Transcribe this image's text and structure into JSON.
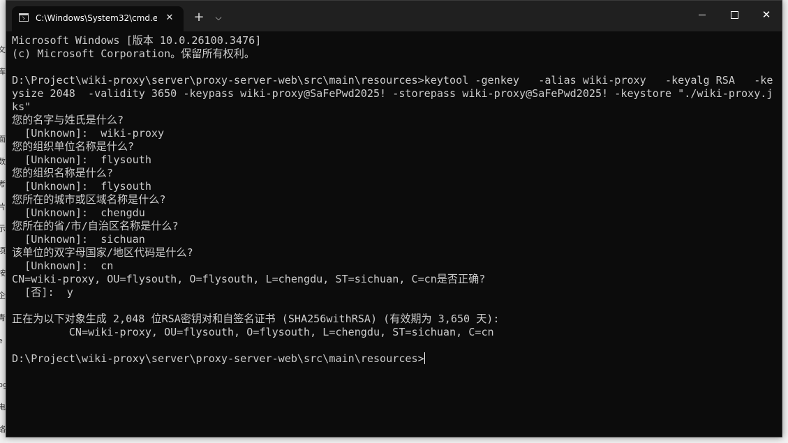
{
  "window": {
    "tab_title": "C:\\Windows\\System32\\cmd.e",
    "tab_close": "✕",
    "new_tab": "+",
    "tab_dropdown": "⌵",
    "close_glyph": "✕"
  },
  "terminal": {
    "lines": [
      "Microsoft Windows [版本 10.0.26100.3476]",
      "(c) Microsoft Corporation。保留所有权利。",
      "",
      "D:\\Project\\wiki-proxy\\server\\proxy-server-web\\src\\main\\resources>keytool -genkey   -alias wiki-proxy   -keyalg RSA   -ke",
      "ysize 2048  -validity 3650 -keypass wiki-proxy@SaFePwd2025! -storepass wiki-proxy@SaFePwd2025! -keystore \"./wiki-proxy.j",
      "ks\"",
      "您的名字与姓氏是什么?",
      "  [Unknown]:  wiki-proxy",
      "您的组织单位名称是什么?",
      "  [Unknown]:  flysouth",
      "您的组织名称是什么?",
      "  [Unknown]:  flysouth",
      "您所在的城市或区域名称是什么?",
      "  [Unknown]:  chengdu",
      "您所在的省/市/自治区名称是什么?",
      "  [Unknown]:  sichuan",
      "该单位的双字母国家/地区代码是什么?",
      "  [Unknown]:  cn",
      "CN=wiki-proxy, OU=flysouth, O=flysouth, L=chengdu, ST=sichuan, C=cn是否正确?",
      "  [否]:  y",
      "",
      "正在为以下对象生成 2,048 位RSA密钥对和自签名证书 (SHA256withRSA) (有效期为 3,650 天):",
      "         CN=wiki-proxy, OU=flysouth, O=flysouth, L=chengdu, ST=sichuan, C=cn",
      "",
      "D:\\Project\\wiki-proxy\\server\\proxy-server-web\\src\\main\\resources>"
    ]
  },
  "background_app": {
    "glyphs": [
      "文",
      "库",
      "面",
      "数",
      "考",
      "片",
      "示",
      "项",
      "按",
      "企",
      "青",
      "e",
      "pg",
      "电",
      "络"
    ]
  }
}
